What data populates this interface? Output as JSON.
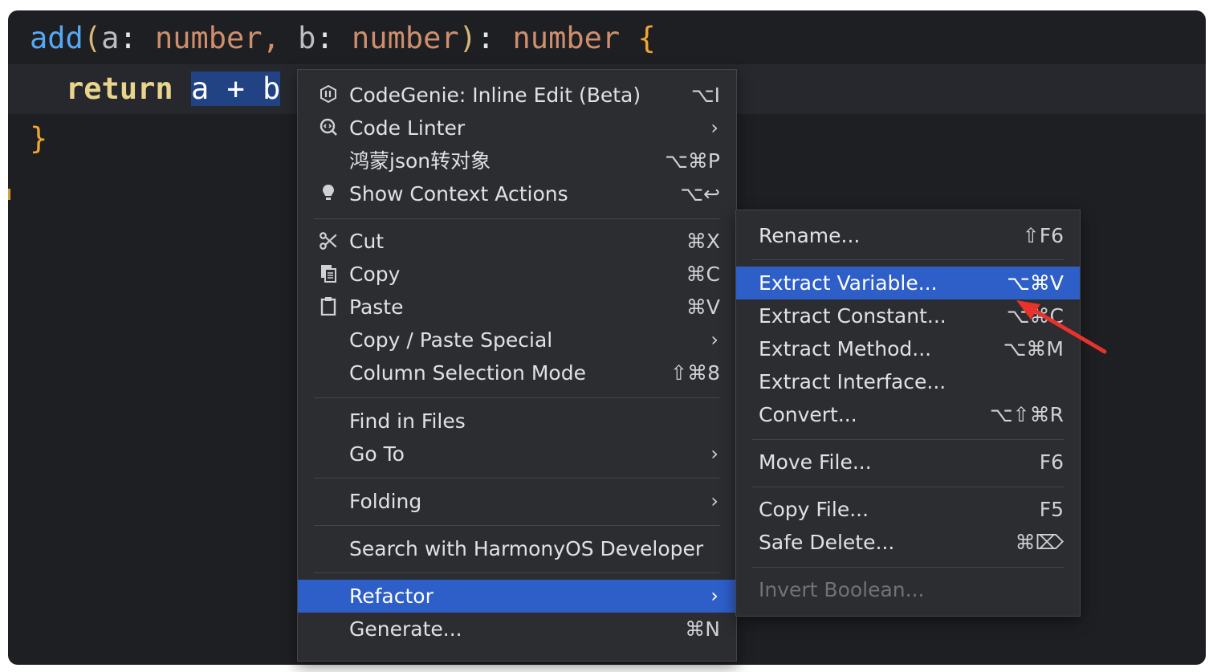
{
  "editor": {
    "line1": {
      "fn": "add",
      "open_paren": "(",
      "param_a": "a",
      "colon1": ": ",
      "type1": "number",
      "comma": ",",
      "space": " ",
      "param_b": "b",
      "colon2": ": ",
      "type2": "number",
      "close_paren": ")",
      "colon3": ": ",
      "type3": "number",
      "space2": " ",
      "open_brace": "{"
    },
    "line2": {
      "keyword": "return",
      "space": " ",
      "selected": "a + b"
    },
    "line3": {
      "close_brace": "}"
    }
  },
  "context_menu": {
    "items": [
      {
        "label": "CodeGenie: Inline Edit (Beta)",
        "shortcut": "⌥I",
        "icon": "codegenie-icon"
      },
      {
        "label": "Code Linter",
        "submenu": true,
        "icon": "code-linter-icon"
      },
      {
        "label": "鸿蒙json转对象",
        "shortcut": "⌥⌘P"
      },
      {
        "label": "Show Context Actions",
        "shortcut": "⌥↩",
        "icon": "lightbulb-icon"
      },
      {
        "label": "Cut",
        "shortcut": "⌘X",
        "icon": "scissors-icon"
      },
      {
        "label": "Copy",
        "shortcut": "⌘C",
        "icon": "copy-icon"
      },
      {
        "label": "Paste",
        "shortcut": "⌘V",
        "icon": "clipboard-icon"
      },
      {
        "label": "Copy / Paste Special",
        "submenu": true
      },
      {
        "label": "Column Selection Mode",
        "shortcut": "⇧⌘8"
      },
      {
        "label": "Find in Files"
      },
      {
        "label": "Go To",
        "submenu": true
      },
      {
        "label": "Folding",
        "submenu": true
      },
      {
        "label": "Search with HarmonyOS Developer"
      },
      {
        "label": "Refactor",
        "submenu": true,
        "active": true
      },
      {
        "label": "Generate...",
        "shortcut": "⌘N"
      }
    ],
    "chevron": "›"
  },
  "refactor_menu": {
    "items": [
      {
        "label": "Rename...",
        "shortcut": "⇧F6"
      },
      {
        "label": "Extract Variable...",
        "shortcut": "⌥⌘V",
        "active": true
      },
      {
        "label": "Extract Constant...",
        "shortcut": "⌥⌘C"
      },
      {
        "label": "Extract Method...",
        "shortcut": "⌥⌘M"
      },
      {
        "label": "Extract Interface..."
      },
      {
        "label": "Convert...",
        "shortcut": "⌥⇧⌘R"
      },
      {
        "label": "Move File...",
        "shortcut": "F6"
      },
      {
        "label": "Copy File...",
        "shortcut": "F5"
      },
      {
        "label": "Safe Delete...",
        "shortcut": "⌘⌦"
      },
      {
        "label": "Invert Boolean...",
        "disabled": true
      }
    ]
  },
  "colors": {
    "background": "#1e1f22",
    "menu_bg": "#2b2d30",
    "highlight": "#2e5ec8",
    "selection": "#214283",
    "annotation_arrow": "#e8322c"
  }
}
